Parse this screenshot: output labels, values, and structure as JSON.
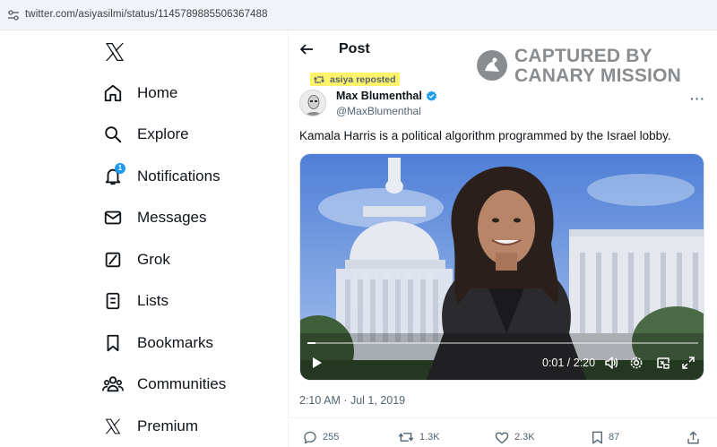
{
  "browser": {
    "url": "twitter.com/asiyasilmi/status/1145789885506367488"
  },
  "sidebar": {
    "logo_icon": "x-logo-icon",
    "items": [
      {
        "label": "Home",
        "icon": "home-icon"
      },
      {
        "label": "Explore",
        "icon": "search-icon"
      },
      {
        "label": "Notifications",
        "icon": "bell-icon",
        "badge": "1"
      },
      {
        "label": "Messages",
        "icon": "envelope-icon"
      },
      {
        "label": "Grok",
        "icon": "grok-icon"
      },
      {
        "label": "Lists",
        "icon": "list-icon"
      },
      {
        "label": "Bookmarks",
        "icon": "bookmark-icon"
      },
      {
        "label": "Communities",
        "icon": "people-icon"
      },
      {
        "label": "Premium",
        "icon": "x-logo-icon"
      }
    ]
  },
  "header": {
    "title": "Post"
  },
  "watermark": {
    "line1": "CAPTURED BY",
    "line2": "CANARY MISSION"
  },
  "tweet": {
    "repost_label": "asiya reposted",
    "author_name": "Max Blumenthal",
    "author_handle": "@MaxBlumenthal",
    "text": "Kamala Harris is a political algorithm programmed by the Israel lobby.",
    "timestamp": "2:10 AM · Jul 1, 2019",
    "video": {
      "time_display": "0:01 / 2:20",
      "progress_fraction": 0.007
    },
    "stats": {
      "replies": "255",
      "reposts": "1.3K",
      "likes": "2.3K",
      "bookmarks": "87"
    }
  },
  "colors": {
    "accent": "#1d9bf0",
    "highlight": "#fff36b",
    "text": "#0f1419",
    "muted": "#536471"
  }
}
